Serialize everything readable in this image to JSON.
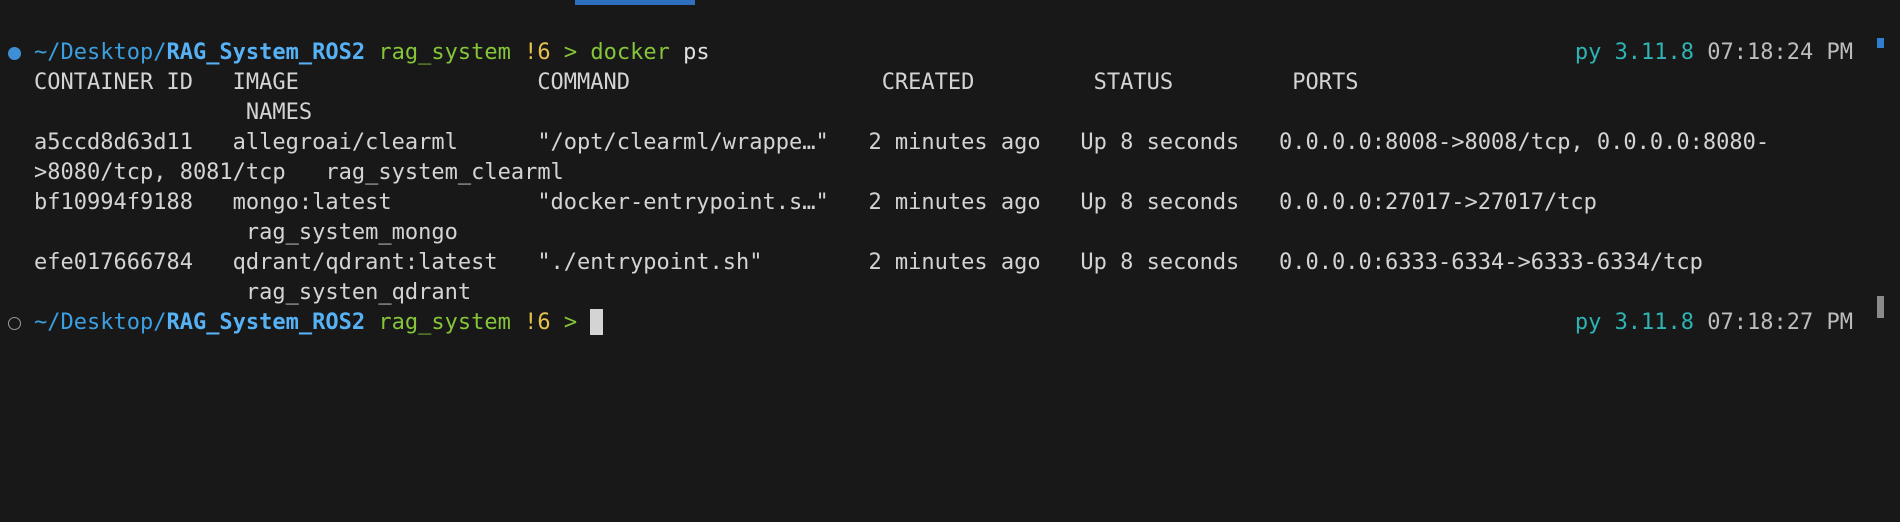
{
  "window": {
    "accent": "#2f6fbf"
  },
  "prompt": {
    "cwd_prefix": "~/Desktop/",
    "repo": "RAG_System_ROS2",
    "branch": "rag_system",
    "changes": "!6",
    "arrow": ">",
    "python_label": "py 3.11.8"
  },
  "commands": [
    {
      "command": "docker",
      "args": "ps",
      "time": "07:18:24 PM"
    },
    {
      "command": "",
      "args": "",
      "time": "07:18:27 PM"
    }
  ],
  "output": {
    "header_line_1": "CONTAINER ID   IMAGE                  COMMAND                   CREATED         STATUS         PORTS",
    "header_line_2": "                NAMES",
    "rows": [
      {
        "line1": "a5ccd8d63d11   allegroai/clearml      \"/opt/clearml/wrappe…\"   2 minutes ago   Up 8 seconds   0.0.0.0:8008->8008/tcp, 0.0.0.0:8080-",
        "line2": ">8080/tcp, 8081/tcp   rag_system_clearml"
      },
      {
        "line1": "bf10994f9188   mongo:latest           \"docker-entrypoint.s…\"   2 minutes ago   Up 8 seconds   0.0.0.0:27017->27017/tcp",
        "line2": "                rag_system_mongo"
      },
      {
        "line1": "efe017666784   qdrant/qdrant:latest   \"./entrypoint.sh\"        2 minutes ago   Up 8 seconds   0.0.0.0:6333-6334->6333-6334/tcp",
        "line2": "                rag_systen_qdrant"
      }
    ]
  }
}
